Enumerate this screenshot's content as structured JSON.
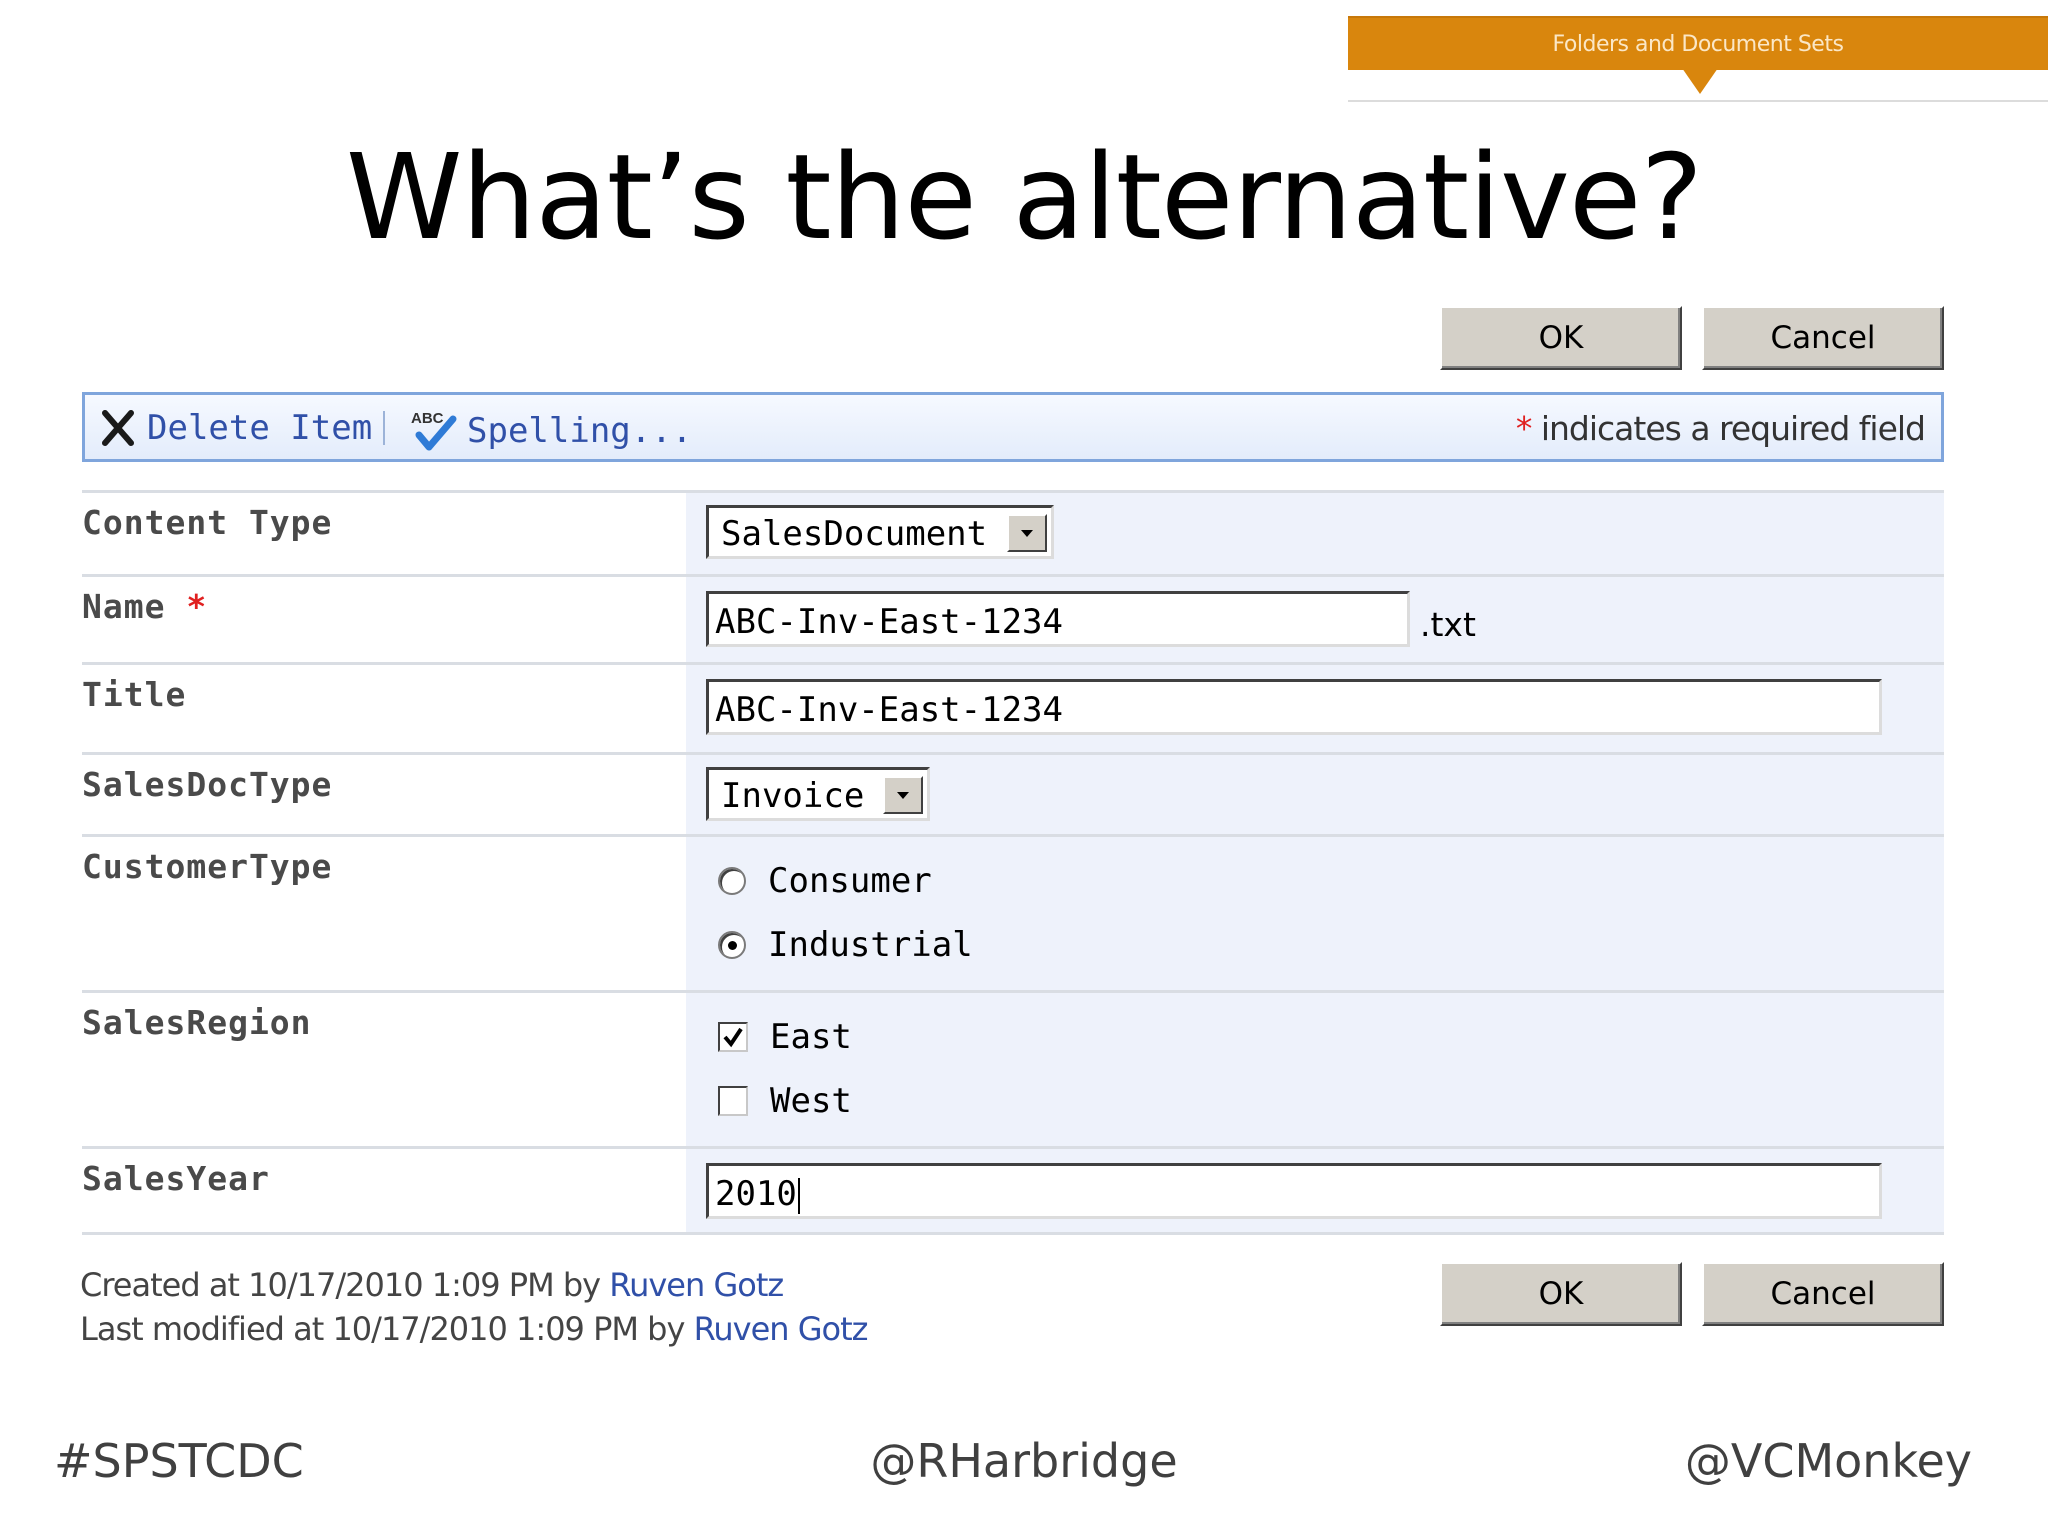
{
  "banner": {
    "label": "Folders and Document Sets"
  },
  "slide": {
    "title": "What’s the alternative?"
  },
  "buttons": {
    "ok": "OK",
    "cancel": "Cancel"
  },
  "toolbar": {
    "delete_label": "Delete Item",
    "spelling_label": "Spelling...",
    "spelling_icon_text": "ABC",
    "required_star": "*",
    "required_note": " indicates a required field"
  },
  "form": {
    "content_type": {
      "label": "Content Type",
      "value": "SalesDocument"
    },
    "name": {
      "label": "Name",
      "required_star": "*",
      "value": "ABC-Inv-East-1234",
      "suffix": ".txt"
    },
    "title": {
      "label": "Title",
      "value": "ABC-Inv-East-1234"
    },
    "sales_doc_type": {
      "label": "SalesDocType",
      "value": "Invoice"
    },
    "customer_type": {
      "label": "CustomerType",
      "options": [
        "Consumer",
        "Industrial"
      ],
      "selected": "Industrial"
    },
    "sales_region": {
      "label": "SalesRegion",
      "options": [
        "East",
        "West"
      ],
      "checked": [
        "East"
      ]
    },
    "sales_year": {
      "label": "SalesYear",
      "value": "2010"
    }
  },
  "meta": {
    "created_prefix": "Created at 10/17/2010 1:09 PM  by ",
    "created_by": "Ruven Gotz",
    "modified_prefix": "Last modified at 10/17/2010 1:09 PM  by ",
    "modified_by": "Ruven Gotz"
  },
  "footer": {
    "left": "#SPSTCDC",
    "center": "@RHarbridge",
    "right": "@VCMonkey"
  },
  "colors": {
    "banner": "#d9860d",
    "link": "#3050a8",
    "required": "#e02020",
    "field_bg": "#eef2fb"
  }
}
